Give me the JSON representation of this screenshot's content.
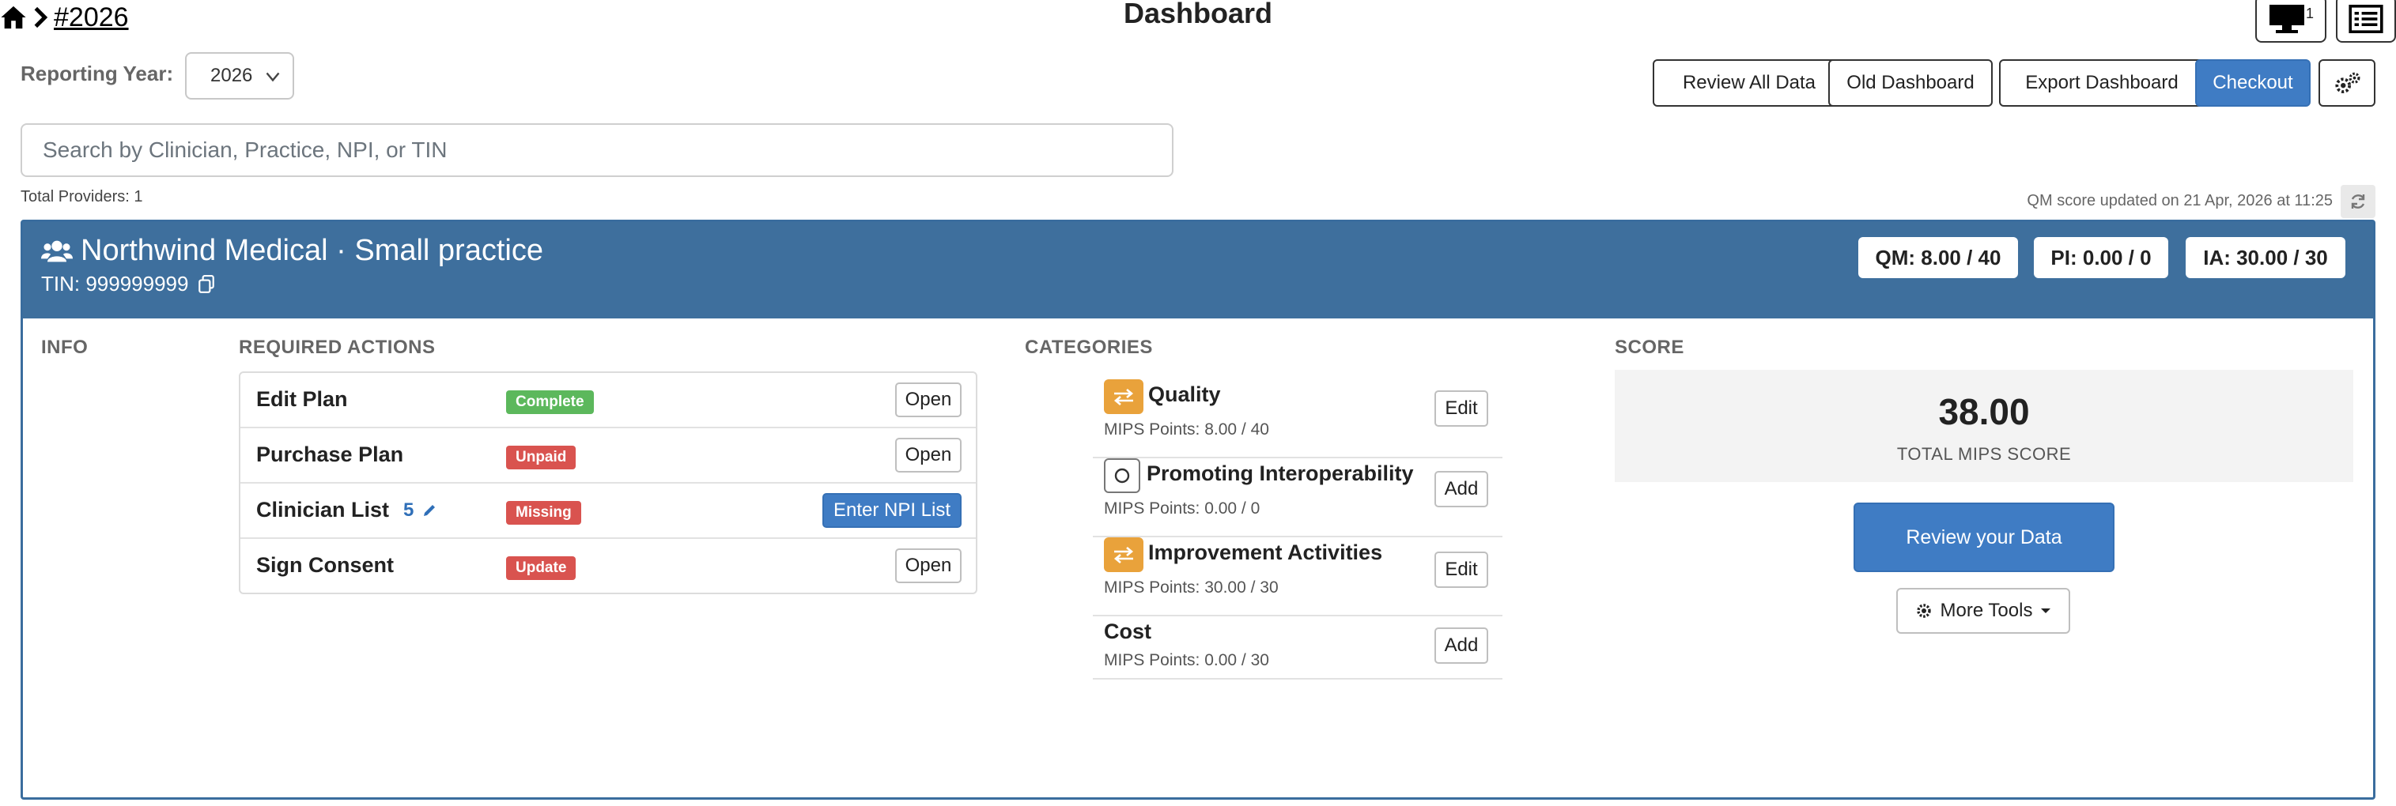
{
  "breadcrumb": {
    "home_icon": "home-icon",
    "separator_icon": "chevron-right-icon",
    "current": "#2026"
  },
  "page": {
    "title": "Dashboard"
  },
  "top_icons": {
    "monitor_count": "1"
  },
  "reporting_year": {
    "label": "Reporting Year:",
    "value": "2026"
  },
  "toolbar": {
    "review_all": "Review All Data",
    "old_dashboard": "Old Dashboard",
    "export": "Export Dashboard",
    "checkout": "Checkout"
  },
  "search": {
    "placeholder": "Search by Clinician, Practice, NPI, or TIN"
  },
  "total_providers": "Total Providers: 1",
  "qm_updated": "QM score updated on 21 Apr, 2026 at 11:25",
  "practice": {
    "name": "Northwind Medical · Small practice",
    "tin": "TIN: 999999999",
    "scores": {
      "qm": "QM: 8.00 / 40",
      "pi": "PI: 0.00 / 0",
      "ia": "IA: 30.00 / 30"
    }
  },
  "columns": {
    "info": "INFO",
    "actions": "REQUIRED ACTIONS",
    "categories": "CATEGORIES",
    "score": "SCORE"
  },
  "actions": [
    {
      "label": "Edit Plan",
      "status": "Complete",
      "button": "Open"
    },
    {
      "label": "Purchase Plan",
      "status": "Unpaid",
      "button": "Open"
    },
    {
      "label": "Clinician List",
      "count": "5",
      "status": "Missing",
      "button": "Enter NPI List"
    },
    {
      "label": "Sign Consent",
      "status": "Update",
      "button": "Open"
    }
  ],
  "categories": [
    {
      "name": "Quality",
      "points": "MIPS Points: 8.00 / 40",
      "button": "Edit"
    },
    {
      "name": "Promoting Interoperability",
      "points": "MIPS Points: 0.00 / 0",
      "button": "Add"
    },
    {
      "name": "Improvement Activities",
      "points": "MIPS Points: 30.00 / 30",
      "button": "Edit"
    },
    {
      "name": "Cost",
      "points": "MIPS Points: 0.00 / 30",
      "button": "Add"
    }
  ],
  "score": {
    "value": "38.00",
    "label": "TOTAL MIPS SCORE",
    "review_button": "Review your Data",
    "more_tools": "More Tools"
  },
  "colors": {
    "primary": "#3f7cc4",
    "header": "#3e6f9d",
    "complete": "#5cb85c",
    "alert": "#d9534f",
    "category_icon": "#e9a23b"
  }
}
